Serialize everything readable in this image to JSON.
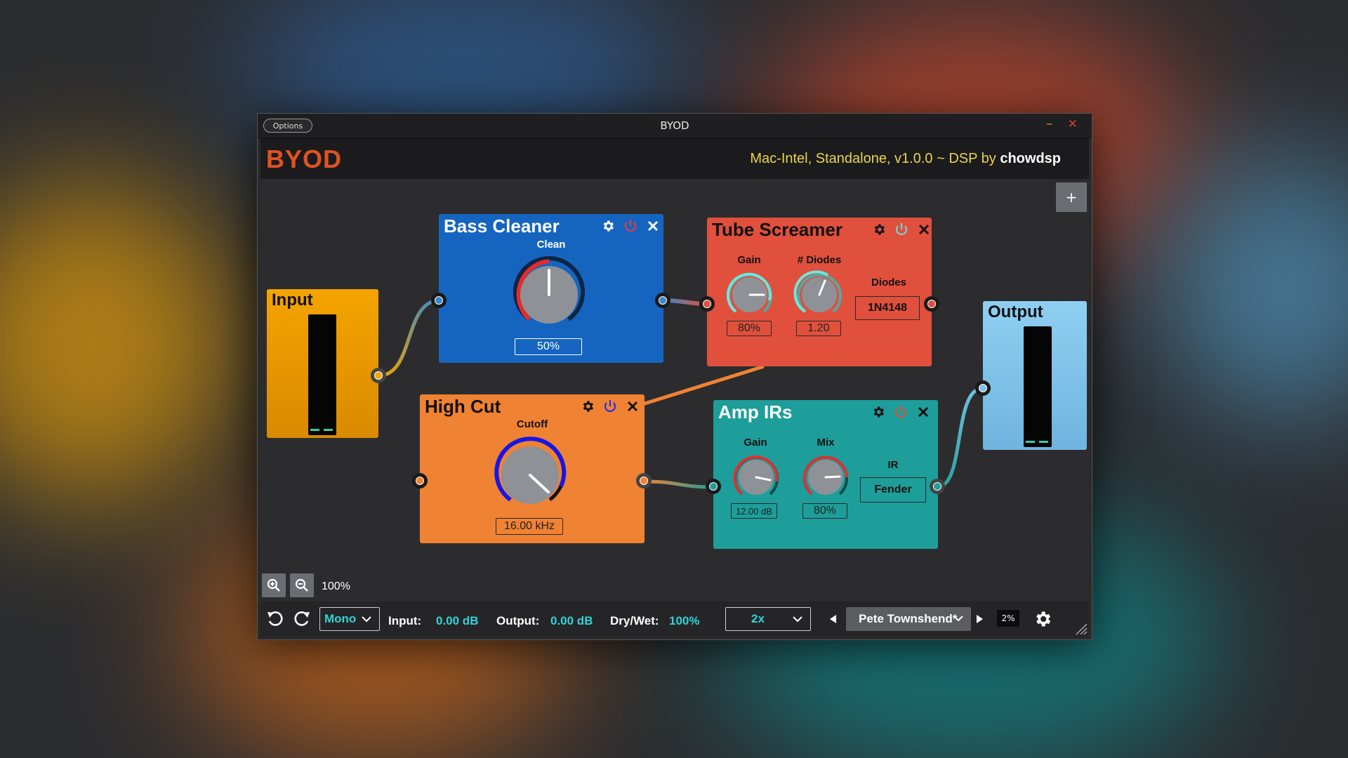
{
  "window": {
    "title": "BYOD",
    "options_label": "Options",
    "minimize_glyph": "–",
    "close_glyph": "✕"
  },
  "header": {
    "logo": "BYOD",
    "version_prefix": "Mac-Intel, Standalone, v1.0.0 ~ DSP by ",
    "version_author": "chowdsp"
  },
  "canvas": {
    "add_label": "+",
    "zoom_level": "100%"
  },
  "modules": {
    "input": {
      "title": "Input",
      "color": "#f0a500"
    },
    "bass_cleaner": {
      "title": "Bass Cleaner",
      "color": "#1565c0",
      "param_label": "Clean",
      "value": "50%",
      "knob_level": 0.5
    },
    "tube_screamer": {
      "title": "Tube Screamer",
      "color": "#e0503d",
      "gain_label": "Gain",
      "gain_value": "80%",
      "diodes_count_label": "# Diodes",
      "diodes_count_value": "1.20",
      "diodes_label": "Diodes",
      "diodes_value": "1N4148"
    },
    "high_cut": {
      "title": "High Cut",
      "color": "#f08234",
      "param_label": "Cutoff",
      "value": "16.00 kHz"
    },
    "amp_irs": {
      "title": "Amp IRs",
      "color": "#1e9e9a",
      "gain_label": "Gain",
      "gain_value": "12.00 dB",
      "mix_label": "Mix",
      "mix_value": "80%",
      "ir_label": "IR",
      "ir_value": "Fender"
    },
    "output": {
      "title": "Output",
      "color": "#7ec3ea"
    }
  },
  "bottom_bar": {
    "mode": "Mono",
    "input_label": "Input:",
    "input_value": "0.00 dB",
    "output_label": "Output:",
    "output_value": "0.00 dB",
    "drywet_label": "Dry/Wet:",
    "drywet_value": "100%",
    "oversampling": "2x",
    "preset": "Pete Townshend*",
    "cpu": "2%"
  },
  "icons": [
    "undo-icon",
    "redo-icon",
    "zoom-in-icon",
    "zoom-out-icon",
    "gear-icon",
    "power-icon",
    "close-icon",
    "chevron-down-icon",
    "arrow-left-icon",
    "arrow-right-icon",
    "resize-grip-icon"
  ]
}
